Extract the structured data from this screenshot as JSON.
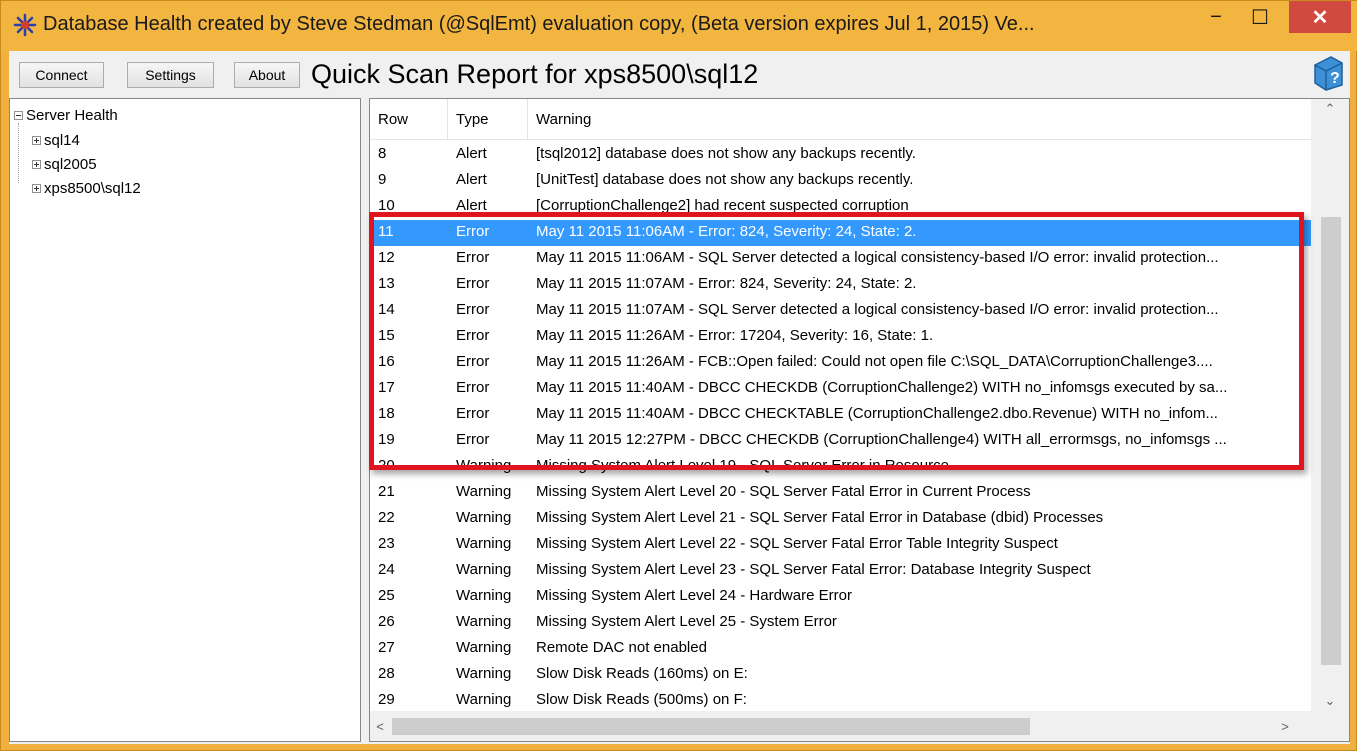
{
  "window": {
    "title": "Database Health created by Steve Stedman (@SqlEmt) evaluation copy, (Beta version expires Jul 1, 2015) Ve...",
    "minimize": "−",
    "maximize": "☐",
    "close": "✕"
  },
  "toolbar": {
    "connect_label": "Connect",
    "settings_label": "Settings",
    "about_label": "About",
    "report_title": "Quick Scan Report for xps8500\\sql12"
  },
  "tree": {
    "root": "Server Health",
    "children": [
      "sql14",
      "sql2005",
      "xps8500\\sql12"
    ]
  },
  "list": {
    "columns": [
      "Row",
      "Type",
      "Warning"
    ],
    "rows": [
      {
        "row": "8",
        "type": "Alert",
        "warning": "[tsql2012] database does not show any backups recently."
      },
      {
        "row": "9",
        "type": "Alert",
        "warning": "[UnitTest] database does not show any backups recently."
      },
      {
        "row": "10",
        "type": "Alert",
        "warning": "[CorruptionChallenge2] had recent suspected corruption"
      },
      {
        "row": "11",
        "type": "Error",
        "warning": "May 11 2015 11:06AM - Error: 824, Severity: 24, State: 2."
      },
      {
        "row": "12",
        "type": "Error",
        "warning": "May 11 2015 11:06AM - SQL Server detected a logical consistency-based I/O error: invalid protection..."
      },
      {
        "row": "13",
        "type": "Error",
        "warning": "May 11 2015 11:07AM - Error: 824, Severity: 24, State: 2."
      },
      {
        "row": "14",
        "type": "Error",
        "warning": "May 11 2015 11:07AM - SQL Server detected a logical consistency-based I/O error: invalid protection..."
      },
      {
        "row": "15",
        "type": "Error",
        "warning": "May 11 2015 11:26AM - Error: 17204, Severity: 16, State: 1."
      },
      {
        "row": "16",
        "type": "Error",
        "warning": "May 11 2015 11:26AM - FCB::Open failed: Could not open file C:\\SQL_DATA\\CorruptionChallenge3...."
      },
      {
        "row": "17",
        "type": "Error",
        "warning": "May 11 2015 11:40AM - DBCC CHECKDB (CorruptionChallenge2) WITH no_infomsgs executed by sa..."
      },
      {
        "row": "18",
        "type": "Error",
        "warning": "May 11 2015 11:40AM - DBCC CHECKTABLE (CorruptionChallenge2.dbo.Revenue) WITH no_infom..."
      },
      {
        "row": "19",
        "type": "Error",
        "warning": "May 11 2015 12:27PM - DBCC CHECKDB (CorruptionChallenge4) WITH all_errormsgs, no_infomsgs ..."
      },
      {
        "row": "20",
        "type": "Warning",
        "warning": "Missing System Alert Level 19 - SQL Server Error in Resource"
      },
      {
        "row": "21",
        "type": "Warning",
        "warning": "Missing System Alert Level 20 - SQL Server Fatal Error in Current Process"
      },
      {
        "row": "22",
        "type": "Warning",
        "warning": "Missing System Alert Level 21 - SQL Server Fatal Error in Database (dbid) Processes"
      },
      {
        "row": "23",
        "type": "Warning",
        "warning": "Missing System Alert Level 22 - SQL Server Fatal Error Table Integrity Suspect"
      },
      {
        "row": "24",
        "type": "Warning",
        "warning": "Missing System Alert Level 23 - SQL Server Fatal Error: Database Integrity Suspect"
      },
      {
        "row": "25",
        "type": "Warning",
        "warning": "Missing System Alert Level 24 - Hardware Error"
      },
      {
        "row": "26",
        "type": "Warning",
        "warning": "Missing System Alert Level 25 - System Error"
      },
      {
        "row": "27",
        "type": "Warning",
        "warning": "Remote DAC not enabled"
      },
      {
        "row": "28",
        "type": "Warning",
        "warning": "Slow Disk Reads (160ms) on E:"
      },
      {
        "row": "29",
        "type": "Warning",
        "warning": "Slow Disk Reads (500ms) on F:"
      }
    ],
    "selected_row": "11"
  },
  "colors": {
    "window_frame": "#f0b040",
    "selection": "#3399ff",
    "highlight_box": "#e0141e"
  },
  "icons": {
    "app": "app-logo-icon",
    "help": "help-book-icon"
  }
}
